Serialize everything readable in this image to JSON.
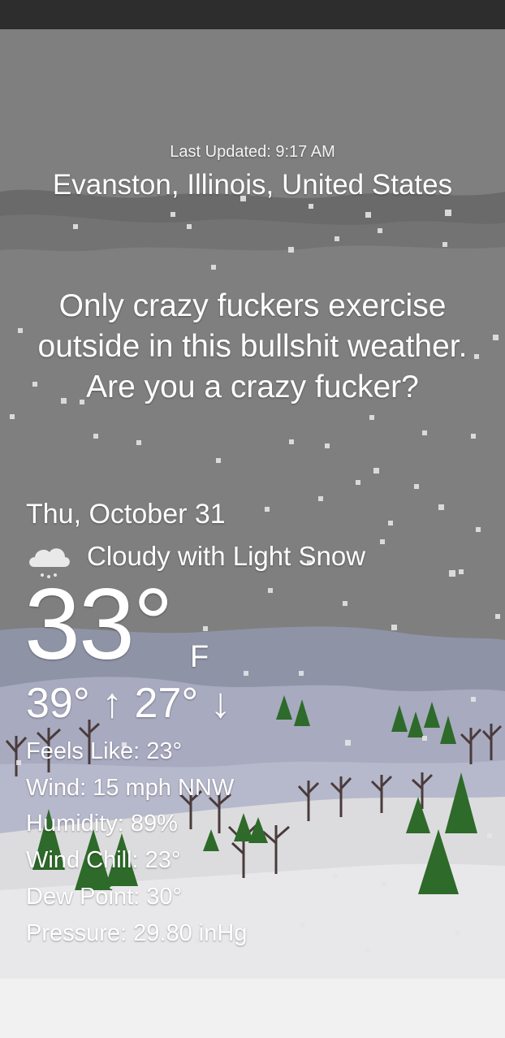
{
  "colors": {
    "sky": "#808080",
    "cloud_band": "#6a6a6a",
    "far_hills": "#8f93a6",
    "mid_hills": "#a9abc0",
    "snow": "#e6e6e8",
    "pine": "#2e6a2a",
    "status_bar": "#2d2d2d"
  },
  "header": {
    "last_updated": "Last Updated: 9:17 AM",
    "location": "Evanston, Illinois, United States"
  },
  "quote": "Only crazy fuckers exercise outside in this bullshit weather. Are you a crazy fucker?",
  "forecast": {
    "date": "Thu, October 31",
    "condition_icon": "cloud-snow-icon",
    "condition": "Cloudy with Light Snow",
    "temperature": "33°",
    "unit": "F",
    "high_low": "39° ↑ 27° ↓"
  },
  "details": {
    "feels_like": "Feels Like: 23°",
    "wind": "Wind: 15 mph NNW",
    "humidity": "Humidity: 89%",
    "wind_chill": "Wind Chill: 23°",
    "dew_point": "Dew Point: 30°",
    "pressure": "Pressure: 29.80 inHg"
  }
}
